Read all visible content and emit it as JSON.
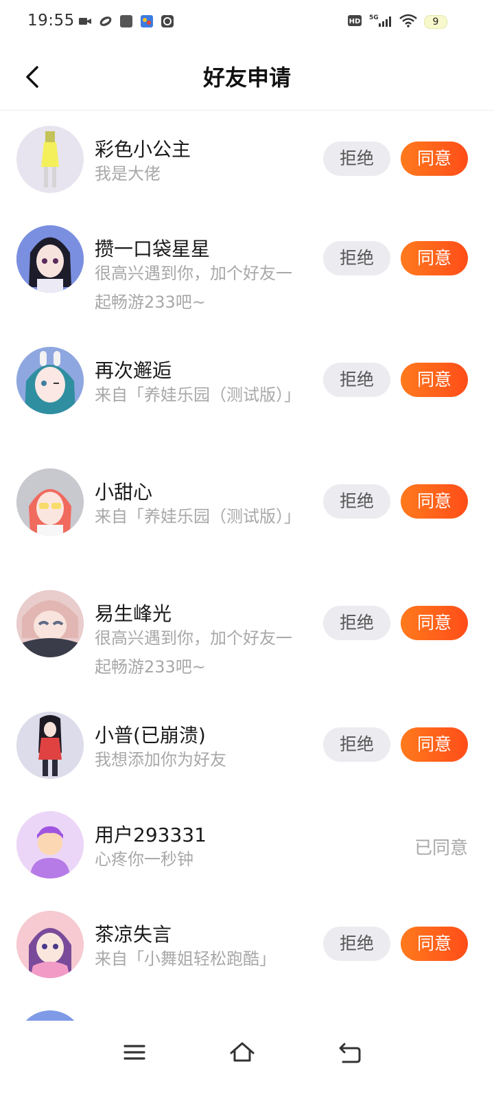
{
  "status_bar": {
    "time": "19:55",
    "left_icons": [
      "video-icon",
      "sync-icon",
      "app-icon",
      "game-icon",
      "chat-app-icon"
    ],
    "right_icons": [
      "hd-icon",
      "signal-5g-icon",
      "wifi-icon"
    ],
    "battery": "9"
  },
  "header": {
    "title": "好友申请"
  },
  "requests": [
    {
      "name": "彩色小公主",
      "message": "我是大佬",
      "reject": "拒绝",
      "accept": "同意",
      "status": "pending"
    },
    {
      "name": "攒一口袋星星",
      "message": "很高兴遇到你，加个好友一起畅游233吧~",
      "reject": "拒绝",
      "accept": "同意",
      "status": "pending"
    },
    {
      "name": "再次邂逅",
      "message": "来自「养娃乐园（测试版）」",
      "reject": "拒绝",
      "accept": "同意",
      "status": "pending"
    },
    {
      "name": "小甜心",
      "message": "来自「养娃乐园（测试版）」",
      "reject": "拒绝",
      "accept": "同意",
      "status": "pending"
    },
    {
      "name": "易生峰光",
      "message": "很高兴遇到你，加个好友一起畅游233吧~",
      "reject": "拒绝",
      "accept": "同意",
      "status": "pending"
    },
    {
      "name": "小普(已崩溃)",
      "message": "我想添加你为好友",
      "reject": "拒绝",
      "accept": "同意",
      "status": "pending"
    },
    {
      "name": "用户293331",
      "message": "心疼你一秒钟",
      "status_text": "已同意",
      "status": "accepted"
    },
    {
      "name": "茶凉失言",
      "message": "来自「小舞姐轻松跑酷」",
      "reject": "拒绝",
      "accept": "同意",
      "status": "pending"
    }
  ],
  "colors": {
    "accent_start": "#ff7a1c",
    "accent_end": "#ff4d1a",
    "reject_bg": "#ebebf0",
    "muted": "#a8a8a8"
  },
  "nav": {
    "icons": [
      "menu-icon",
      "home-icon",
      "back-icon"
    ]
  }
}
